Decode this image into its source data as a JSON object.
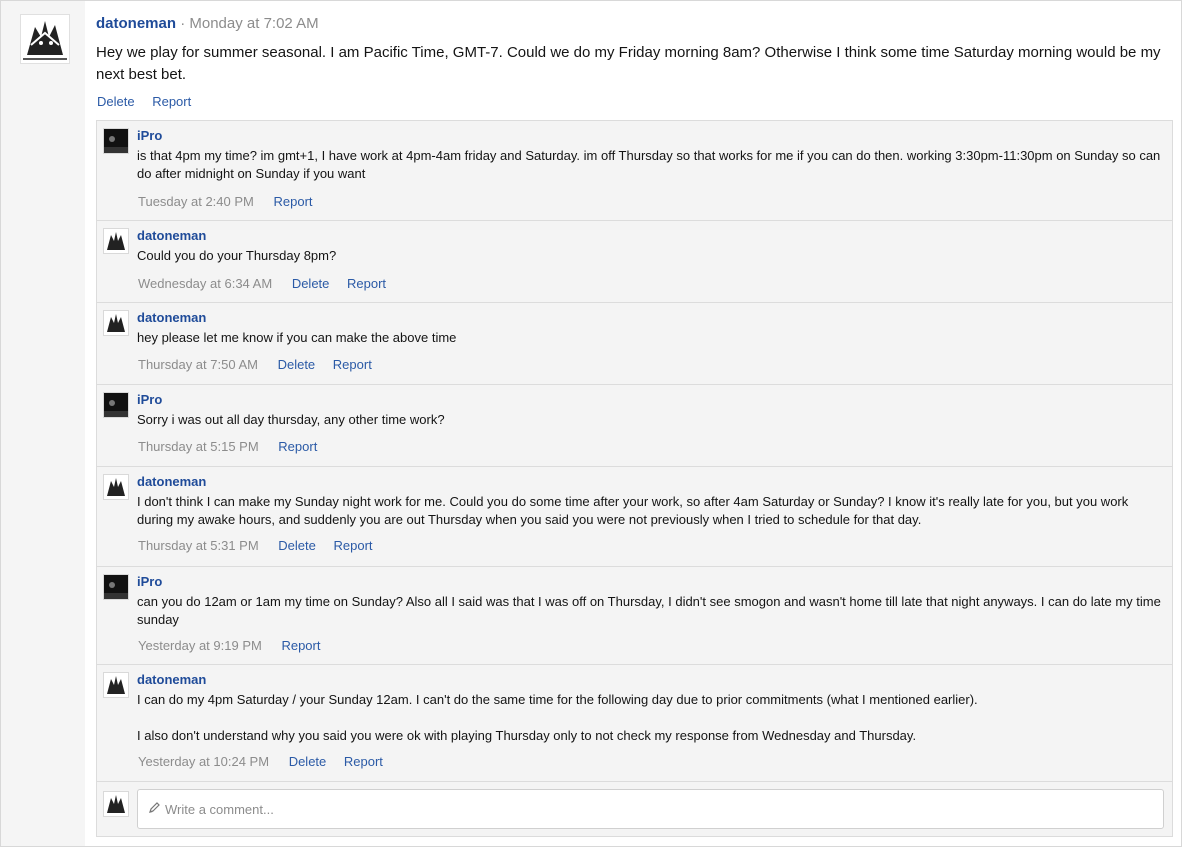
{
  "post": {
    "author": "datoneman",
    "separator": "·",
    "time": "Monday at 7:02 AM",
    "body": "Hey we play for summer seasonal. I am Pacific Time, GMT-7. Could we do my Friday morning 8am? Otherwise I think some time Saturday morning would be my next best bet.",
    "actions": {
      "delete": "Delete",
      "report": "Report"
    }
  },
  "comments": [
    {
      "author": "iPro",
      "text": "is that 4pm my time? im gmt+1, I have work at 4pm-4am friday and Saturday. im off Thursday so that works for me if you can do then. working 3:30pm-11:30pm on Sunday so can do after midnight on Sunday if you want",
      "time": "Tuesday at 2:40 PM",
      "report": "Report"
    },
    {
      "author": "datoneman",
      "text": "Could you do your Thursday 8pm?",
      "time": "Wednesday at 6:34 AM",
      "delete": "Delete",
      "report": "Report"
    },
    {
      "author": "datoneman",
      "text": "hey please let me know if you can make the above time",
      "time": "Thursday at 7:50 AM",
      "delete": "Delete",
      "report": "Report"
    },
    {
      "author": "iPro",
      "text": "Sorry i was out all day thursday, any other time work?",
      "time": "Thursday at 5:15 PM",
      "report": "Report"
    },
    {
      "author": "datoneman",
      "text": "I don't think I can make my Sunday night work for me. Could you do some time after your work, so after 4am Saturday or Sunday? I know it's really late for you, but you work during my awake hours, and suddenly you are out Thursday when you said you were not previously when I tried to schedule for that day.",
      "time": "Thursday at 5:31 PM",
      "delete": "Delete",
      "report": "Report"
    },
    {
      "author": "iPro",
      "text": "can you do 12am or 1am my time on Sunday? Also all I said was that I was off on Thursday, I didn't see smogon and wasn't home till late that night anyways. I can do late my time sunday",
      "time": "Yesterday at 9:19 PM",
      "report": "Report"
    },
    {
      "author": "datoneman",
      "text": "I can do my 4pm Saturday / your Sunday 12am. I can't do the same time for the following day due to prior commitments (what I mentioned earlier).\n\nI also don't understand why you said you were ok with playing Thursday only to not check my response from Wednesday and Thursday.",
      "time": "Yesterday at 10:24 PM",
      "delete": "Delete",
      "report": "Report"
    }
  ],
  "composer": {
    "placeholder": "Write a comment..."
  },
  "icons": {
    "pencil": "pencil-icon"
  }
}
